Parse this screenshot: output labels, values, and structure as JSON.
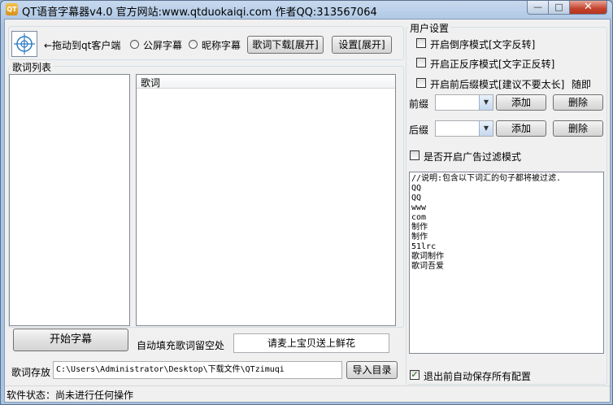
{
  "window": {
    "title": "QT语音字幕器v4.0 官方网站:www.qtduokaiqi.com  作者QQ:313567064",
    "minimize_glyph": "—",
    "maximize_glyph": "□",
    "close_glyph": "✕"
  },
  "toolbar": {
    "drag_hint": "←拖动到qt客户端",
    "radio_public": "公屏字幕",
    "radio_nickname": "昵称字幕",
    "lyrics_download_label": "歌词下载[展开]",
    "settings_label": "设置[展开]"
  },
  "lyrics_list": {
    "group_title": "歌词列表",
    "column_header": "歌词"
  },
  "controls": {
    "start_button": "开始字幕",
    "auto_fill_label": "自动填充歌词留空处",
    "auto_fill_value": "请麦上宝贝送上鲜花",
    "save_path_label": "歌词存放",
    "save_path_value": "C:\\Users\\Administrator\\Desktop\\下载文件\\QTzimuqi",
    "import_button": "导入目录"
  },
  "user_settings": {
    "group_title": "用户设置",
    "reverse_mode": "开启倒序模式[文字反转]",
    "forward_mode": "开启正反序模式[文字正反转]",
    "prefix_suffix_mode": "开启前后缀模式[建议不要太长]",
    "random_label": "随即",
    "prefix_label": "前缀",
    "suffix_label": "后缀",
    "add_label": "添加",
    "delete_label": "删除",
    "ad_filter_label": "是否开启广告过滤模式",
    "filter_lines": [
      "//说明:包含以下词汇的句子都将被过滤.",
      "QQ",
      "QQ",
      "www",
      "com",
      "制作",
      "制作",
      "51lrc",
      "歌词制作",
      "歌词吾爱"
    ],
    "autosave_label": "退出前自动保存所有配置",
    "autosave_check": "✓"
  },
  "status": {
    "text": "软件状态：尚未进行任何操作"
  }
}
